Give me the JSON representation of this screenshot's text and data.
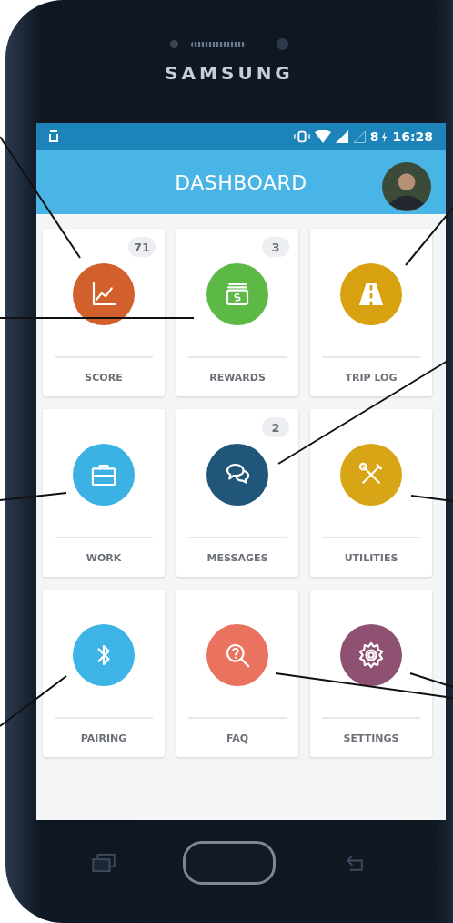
{
  "device": {
    "brand": "SAMSUNG"
  },
  "status_bar": {
    "battery": "8",
    "time": "16:28"
  },
  "header": {
    "title": "DASHBOARD"
  },
  "tiles": [
    {
      "label": "SCORE",
      "badge": "71",
      "color": "#d1602c",
      "kind": "chart"
    },
    {
      "label": "REWARDS",
      "badge": "3",
      "color": "#5db946",
      "kind": "money"
    },
    {
      "label": "TRIP LOG",
      "color": "#d8a10f",
      "kind": "road"
    },
    {
      "label": "WORK",
      "color": "#3cb1e4",
      "kind": "briefcase"
    },
    {
      "label": "MESSAGES",
      "badge": "2",
      "color": "#1f5679",
      "kind": "chat"
    },
    {
      "label": "UTILITIES",
      "color": "#d7a515",
      "kind": "tools"
    },
    {
      "label": "PAIRING",
      "color": "#3db3e6",
      "kind": "bluetooth"
    },
    {
      "label": "FAQ",
      "color": "#ea7360",
      "kind": "faq"
    },
    {
      "label": "SETTINGS",
      "color": "#8e5171",
      "kind": "gear"
    }
  ]
}
